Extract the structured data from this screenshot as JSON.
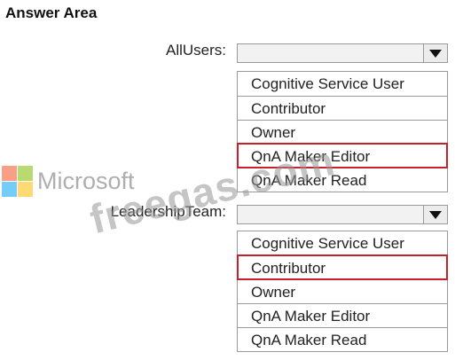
{
  "header": {
    "title": "Answer Area"
  },
  "brand": {
    "logo_text": "Microsoft",
    "watermark": "freegas.com",
    "colors": {
      "red": "#f25022",
      "green": "#7fba00",
      "blue": "#00a4ef",
      "yellow": "#ffb900",
      "highlight": "#c8202a"
    }
  },
  "allusers": {
    "label": "AllUsers:",
    "selected": "",
    "options": [
      "Cognitive Service User",
      "Contributor",
      "Owner",
      "QnA Maker Editor",
      "QnA Maker Read"
    ],
    "highlighted_option": "QnA Maker Editor"
  },
  "leadership": {
    "label": "LeadershipTeam:",
    "selected": "",
    "options": [
      "Cognitive Service User",
      "Contributor",
      "Owner",
      "QnA Maker Editor",
      "QnA Maker Read"
    ],
    "highlighted_option": "Contributor"
  }
}
